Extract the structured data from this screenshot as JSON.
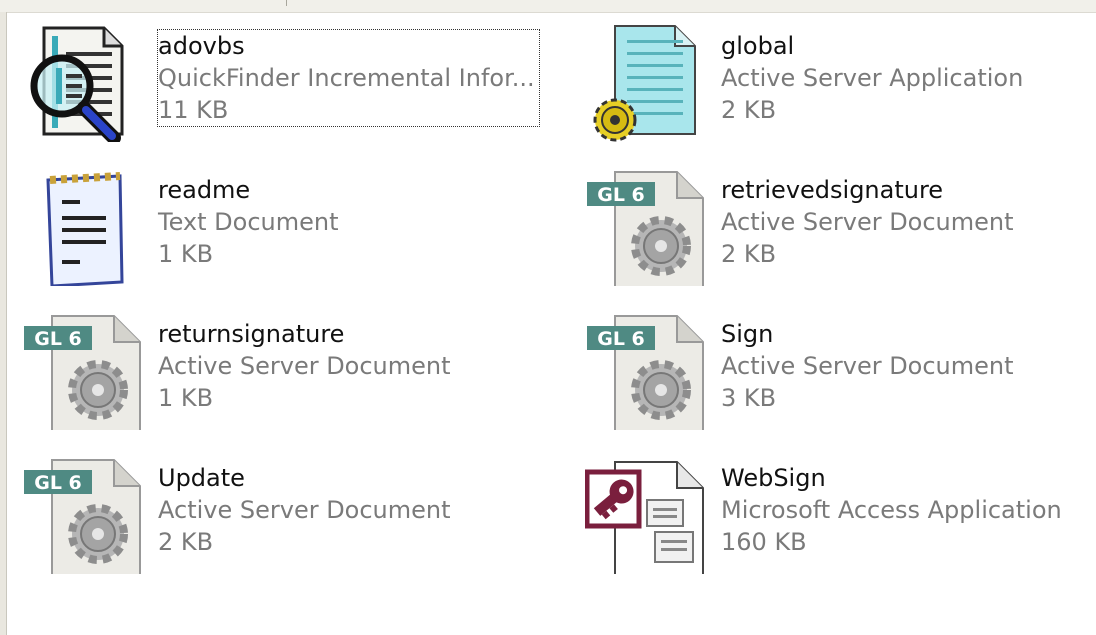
{
  "files": [
    {
      "name": "adovbs",
      "type": "QuickFinder Incremental Infor...",
      "size": "11 KB",
      "icon": "quickfinder-icon"
    },
    {
      "name": "global",
      "type": "Active Server Application",
      "size": "2 KB",
      "icon": "asa-icon"
    },
    {
      "name": "readme",
      "type": "Text Document",
      "size": "1 KB",
      "icon": "text-document-icon"
    },
    {
      "name": "retrievedsignature",
      "type": "Active Server Document",
      "size": "2 KB",
      "icon": "asp-icon",
      "badge": "GL 6"
    },
    {
      "name": "returnsignature",
      "type": "Active Server Document",
      "size": "1 KB",
      "icon": "asp-icon",
      "badge": "GL 6"
    },
    {
      "name": "Sign",
      "type": "Active Server Document",
      "size": "3 KB",
      "icon": "asp-icon",
      "badge": "GL 6"
    },
    {
      "name": "Update",
      "type": "Active Server Document",
      "size": "2 KB",
      "icon": "asp-icon",
      "badge": "GL 6"
    },
    {
      "name": "WebSign",
      "type": "Microsoft Access Application",
      "size": "160 KB",
      "icon": "access-icon"
    }
  ],
  "colors": {
    "asp_badge": "#4f8a83",
    "access_brand": "#7a1f3d",
    "gear": "#8d8d8d",
    "text_secondary": "#7a7a7a"
  }
}
